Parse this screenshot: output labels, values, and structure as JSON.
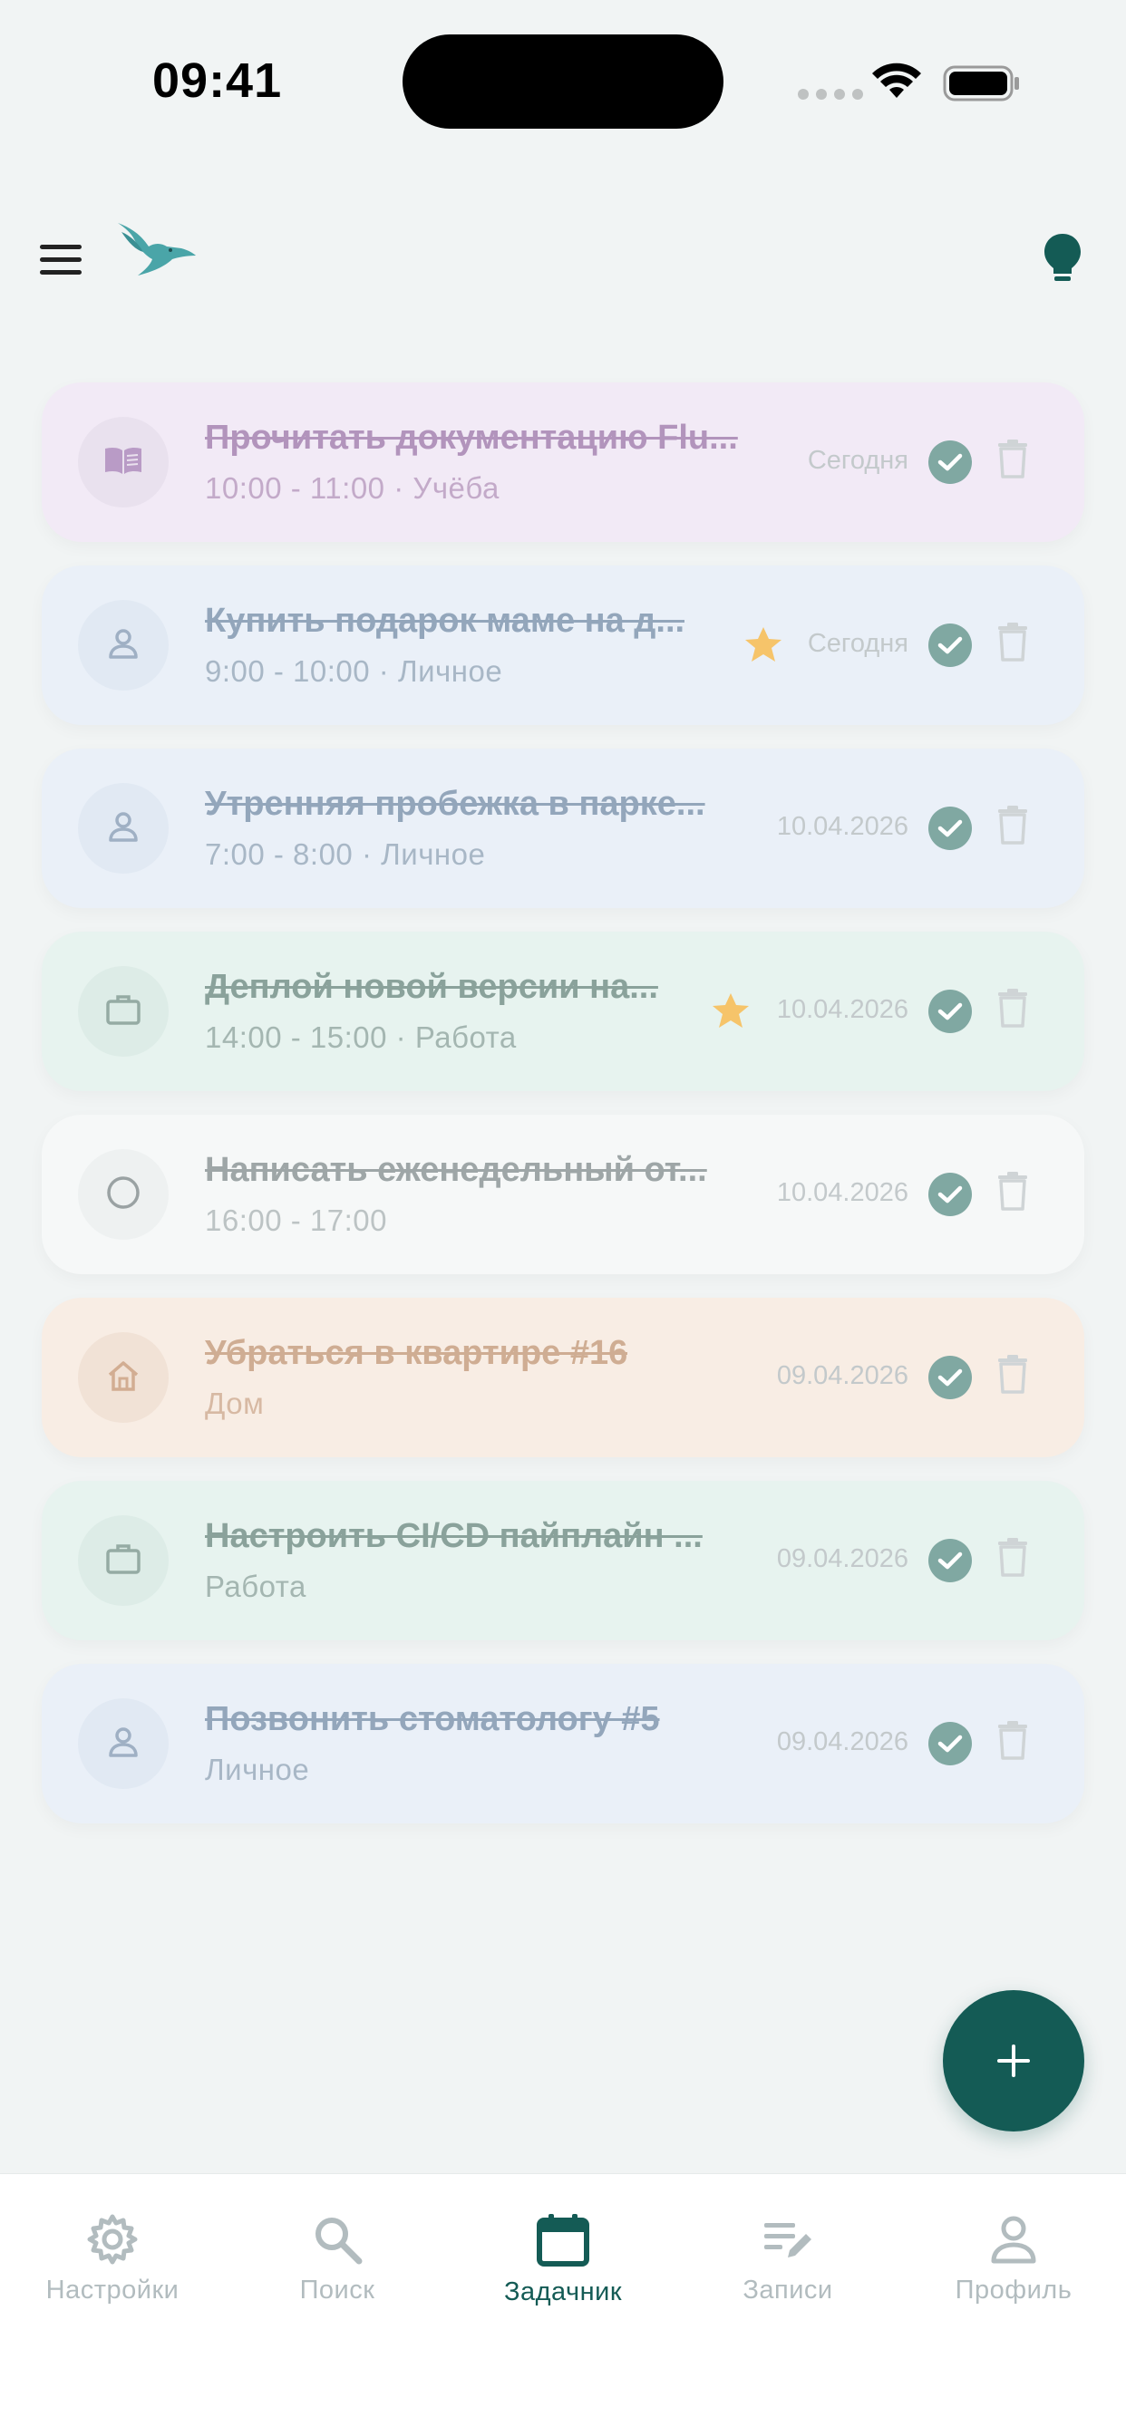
{
  "status_bar": {
    "time": "09:41"
  },
  "tasks": [
    {
      "title": "Прочитать документацию Flu...",
      "subtitle": "10:00 - 11:00 · Учёба",
      "date": "Сегодня",
      "starred": false,
      "category_icon": "book-icon",
      "bg": "#f2eaf6",
      "circle_bg": "#e9e1ee",
      "title_color": "#b294bc",
      "subtitle_color": "#c3aac9",
      "icon_color": "#b99bc6"
    },
    {
      "title": "Купить подарок маме на д...",
      "subtitle": "9:00 - 10:00 · Личное",
      "date": "Сегодня",
      "starred": true,
      "category_icon": "person-icon",
      "bg": "#eaf0f8",
      "circle_bg": "#e1e9f3",
      "title_color": "#93a6bb",
      "subtitle_color": "#a8b7c6",
      "icon_color": "#9fb0c4"
    },
    {
      "title": "Утренняя пробежка в парке...",
      "subtitle": "7:00 - 8:00 · Личное",
      "date": "10.04.2026",
      "starred": false,
      "category_icon": "person-icon",
      "bg": "#eaf0f8",
      "circle_bg": "#e1e9f3",
      "title_color": "#93a6bb",
      "subtitle_color": "#a8b7c6",
      "icon_color": "#9fb0c4"
    },
    {
      "title": "Деплой новой версии на...",
      "subtitle": "14:00 - 15:00 · Работа",
      "date": "10.04.2026",
      "starred": true,
      "category_icon": "briefcase-icon",
      "bg": "#e7f3ef",
      "circle_bg": "#ddece7",
      "title_color": "#8aa29b",
      "subtitle_color": "#a4b6b1",
      "icon_color": "#95aba4"
    },
    {
      "title": "Написать еженедельный от...",
      "subtitle": "16:00 - 17:00",
      "date": "10.04.2026",
      "starred": false,
      "category_icon": "circle-outline-icon",
      "bg": "#f6f8f8",
      "circle_bg": "#eef1f1",
      "title_color": "#9ea6a7",
      "subtitle_color": "#bcc3c4",
      "icon_color": "#9aa2a3"
    },
    {
      "title": "Убраться в квартире #16",
      "subtitle": "Дом",
      "date": "09.04.2026",
      "starred": false,
      "category_icon": "home-icon",
      "bg": "#f8ede4",
      "circle_bg": "#f1e2d6",
      "title_color": "#cfad93",
      "subtitle_color": "#d7b9a3",
      "icon_color": "#d2ad92"
    },
    {
      "title": "Настроить CI/CD пайплайн ...",
      "subtitle": "Работа",
      "date": "09.04.2026",
      "starred": false,
      "category_icon": "briefcase-icon",
      "bg": "#e7f3ef",
      "circle_bg": "#ddece7",
      "title_color": "#8aa29b",
      "subtitle_color": "#a4b6b1",
      "icon_color": "#95aba4"
    },
    {
      "title": "Позвонить стоматологу #5",
      "subtitle": "Личное",
      "date": "09.04.2026",
      "starred": false,
      "category_icon": "person-icon",
      "bg": "#eaf0f8",
      "circle_bg": "#e1e9f3",
      "title_color": "#93a6bb",
      "subtitle_color": "#a8b7c6",
      "icon_color": "#9fb0c4"
    }
  ],
  "nav": {
    "items": [
      {
        "label": "Настройки",
        "icon": "gear-icon",
        "active": false
      },
      {
        "label": "Поиск",
        "icon": "search-icon",
        "active": false
      },
      {
        "label": "Задачник",
        "icon": "calendar-icon",
        "active": true
      },
      {
        "label": "Записи",
        "icon": "notes-edit-icon",
        "active": false
      },
      {
        "label": "Профиль",
        "icon": "profile-icon",
        "active": false
      }
    ]
  },
  "colors": {
    "accent": "#145b55",
    "check": "#80a8a2",
    "star": "#f6c46a",
    "nav_inactive": "#b2bcbf",
    "background": "#f1f4f4"
  }
}
